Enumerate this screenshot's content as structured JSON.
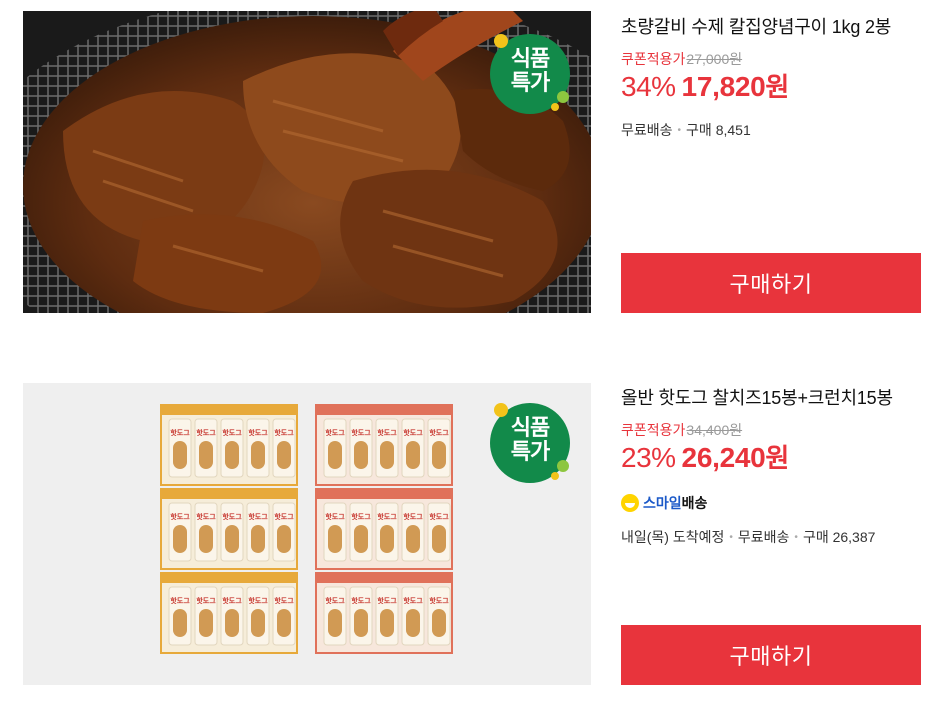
{
  "products": [
    {
      "title": "초량갈비 수제 칼집양념구이 1kg 2봉",
      "coupon_label": "쿠폰적용가",
      "original_price": "27,000원",
      "discount": "34%",
      "price": "17,820",
      "currency": "원",
      "badge": [
        "식품",
        "특가"
      ],
      "meta": [
        "무료배송",
        "구매 8,451"
      ],
      "button": "구매하기",
      "image": "marinated-galbi-on-grill"
    },
    {
      "title": "올반 핫도그 찰치즈15봉+크런치15봉",
      "coupon_label": "쿠폰적용가",
      "original_price": "34,400원",
      "discount": "23%",
      "price": "26,240",
      "currency": "원",
      "badge": [
        "식품",
        "특가"
      ],
      "delivery_badge": {
        "prefix": "스마일",
        "suffix": "배송"
      },
      "meta": [
        "내일(목) 도착예정",
        "무료배송",
        "구매 26,387"
      ],
      "button": "구매하기",
      "image": "hotdog-packages-grid",
      "package_label": "핫도그"
    }
  ],
  "colors": {
    "accent": "#e8343c",
    "badge_green": "#128a4a",
    "badge_yellow": "#f2c31a",
    "badge_lime": "#8dc63f",
    "smile_yellow": "#ffd400"
  }
}
